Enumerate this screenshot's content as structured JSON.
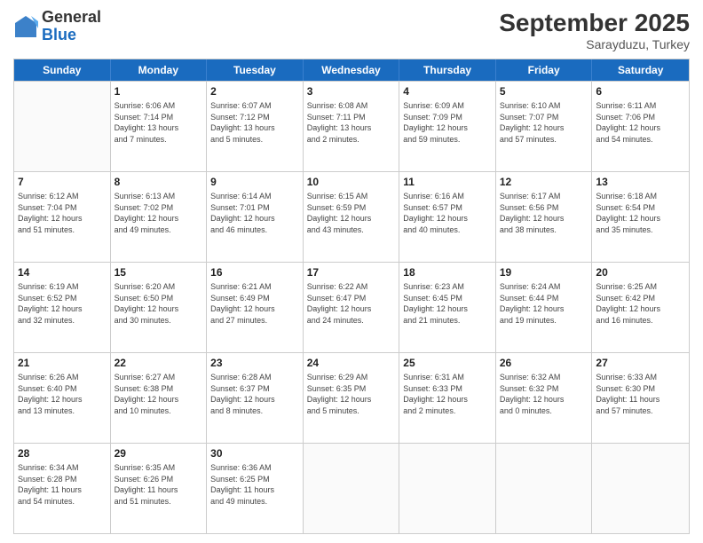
{
  "header": {
    "logo_general": "General",
    "logo_blue": "Blue",
    "month": "September 2025",
    "location": "Sarayduzu, Turkey"
  },
  "weekdays": [
    "Sunday",
    "Monday",
    "Tuesday",
    "Wednesday",
    "Thursday",
    "Friday",
    "Saturday"
  ],
  "rows": [
    [
      {
        "day": "",
        "info": ""
      },
      {
        "day": "1",
        "info": "Sunrise: 6:06 AM\nSunset: 7:14 PM\nDaylight: 13 hours\nand 7 minutes."
      },
      {
        "day": "2",
        "info": "Sunrise: 6:07 AM\nSunset: 7:12 PM\nDaylight: 13 hours\nand 5 minutes."
      },
      {
        "day": "3",
        "info": "Sunrise: 6:08 AM\nSunset: 7:11 PM\nDaylight: 13 hours\nand 2 minutes."
      },
      {
        "day": "4",
        "info": "Sunrise: 6:09 AM\nSunset: 7:09 PM\nDaylight: 12 hours\nand 59 minutes."
      },
      {
        "day": "5",
        "info": "Sunrise: 6:10 AM\nSunset: 7:07 PM\nDaylight: 12 hours\nand 57 minutes."
      },
      {
        "day": "6",
        "info": "Sunrise: 6:11 AM\nSunset: 7:06 PM\nDaylight: 12 hours\nand 54 minutes."
      }
    ],
    [
      {
        "day": "7",
        "info": "Sunrise: 6:12 AM\nSunset: 7:04 PM\nDaylight: 12 hours\nand 51 minutes."
      },
      {
        "day": "8",
        "info": "Sunrise: 6:13 AM\nSunset: 7:02 PM\nDaylight: 12 hours\nand 49 minutes."
      },
      {
        "day": "9",
        "info": "Sunrise: 6:14 AM\nSunset: 7:01 PM\nDaylight: 12 hours\nand 46 minutes."
      },
      {
        "day": "10",
        "info": "Sunrise: 6:15 AM\nSunset: 6:59 PM\nDaylight: 12 hours\nand 43 minutes."
      },
      {
        "day": "11",
        "info": "Sunrise: 6:16 AM\nSunset: 6:57 PM\nDaylight: 12 hours\nand 40 minutes."
      },
      {
        "day": "12",
        "info": "Sunrise: 6:17 AM\nSunset: 6:56 PM\nDaylight: 12 hours\nand 38 minutes."
      },
      {
        "day": "13",
        "info": "Sunrise: 6:18 AM\nSunset: 6:54 PM\nDaylight: 12 hours\nand 35 minutes."
      }
    ],
    [
      {
        "day": "14",
        "info": "Sunrise: 6:19 AM\nSunset: 6:52 PM\nDaylight: 12 hours\nand 32 minutes."
      },
      {
        "day": "15",
        "info": "Sunrise: 6:20 AM\nSunset: 6:50 PM\nDaylight: 12 hours\nand 30 minutes."
      },
      {
        "day": "16",
        "info": "Sunrise: 6:21 AM\nSunset: 6:49 PM\nDaylight: 12 hours\nand 27 minutes."
      },
      {
        "day": "17",
        "info": "Sunrise: 6:22 AM\nSunset: 6:47 PM\nDaylight: 12 hours\nand 24 minutes."
      },
      {
        "day": "18",
        "info": "Sunrise: 6:23 AM\nSunset: 6:45 PM\nDaylight: 12 hours\nand 21 minutes."
      },
      {
        "day": "19",
        "info": "Sunrise: 6:24 AM\nSunset: 6:44 PM\nDaylight: 12 hours\nand 19 minutes."
      },
      {
        "day": "20",
        "info": "Sunrise: 6:25 AM\nSunset: 6:42 PM\nDaylight: 12 hours\nand 16 minutes."
      }
    ],
    [
      {
        "day": "21",
        "info": "Sunrise: 6:26 AM\nSunset: 6:40 PM\nDaylight: 12 hours\nand 13 minutes."
      },
      {
        "day": "22",
        "info": "Sunrise: 6:27 AM\nSunset: 6:38 PM\nDaylight: 12 hours\nand 10 minutes."
      },
      {
        "day": "23",
        "info": "Sunrise: 6:28 AM\nSunset: 6:37 PM\nDaylight: 12 hours\nand 8 minutes."
      },
      {
        "day": "24",
        "info": "Sunrise: 6:29 AM\nSunset: 6:35 PM\nDaylight: 12 hours\nand 5 minutes."
      },
      {
        "day": "25",
        "info": "Sunrise: 6:31 AM\nSunset: 6:33 PM\nDaylight: 12 hours\nand 2 minutes."
      },
      {
        "day": "26",
        "info": "Sunrise: 6:32 AM\nSunset: 6:32 PM\nDaylight: 12 hours\nand 0 minutes."
      },
      {
        "day": "27",
        "info": "Sunrise: 6:33 AM\nSunset: 6:30 PM\nDaylight: 11 hours\nand 57 minutes."
      }
    ],
    [
      {
        "day": "28",
        "info": "Sunrise: 6:34 AM\nSunset: 6:28 PM\nDaylight: 11 hours\nand 54 minutes."
      },
      {
        "day": "29",
        "info": "Sunrise: 6:35 AM\nSunset: 6:26 PM\nDaylight: 11 hours\nand 51 minutes."
      },
      {
        "day": "30",
        "info": "Sunrise: 6:36 AM\nSunset: 6:25 PM\nDaylight: 11 hours\nand 49 minutes."
      },
      {
        "day": "",
        "info": ""
      },
      {
        "day": "",
        "info": ""
      },
      {
        "day": "",
        "info": ""
      },
      {
        "day": "",
        "info": ""
      }
    ]
  ]
}
